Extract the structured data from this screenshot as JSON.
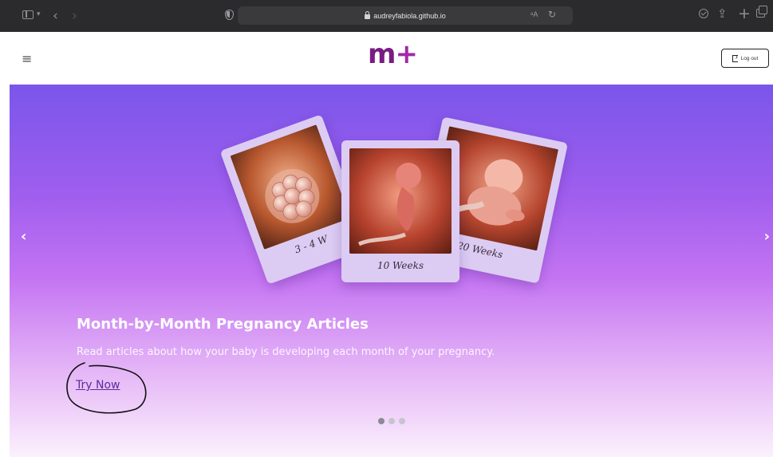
{
  "browser": {
    "url": "audreyfabiola.github.io",
    "translate_label": "ᵃA"
  },
  "site": {
    "logo_main": "m",
    "logo_plus": "+",
    "logout_label": "Log out"
  },
  "hero": {
    "cards": [
      {
        "caption": "3 - 4 W"
      },
      {
        "caption": "10 Weeks"
      },
      {
        "caption": "20 Weeks"
      }
    ],
    "title": "Month-by-Month Pregnancy Articles",
    "subtitle": "Read articles about how your baby is developing each month of your pregnancy.",
    "cta_label": "Try Now",
    "dots_count": 3,
    "active_dot": 0
  },
  "colors": {
    "browser_chrome": "#2b2b2d",
    "logo": "#7a1c82",
    "hero_top": "#7a56ea",
    "hero_bottom": "#fbf1fd",
    "cta_link": "#5b2f9a"
  }
}
